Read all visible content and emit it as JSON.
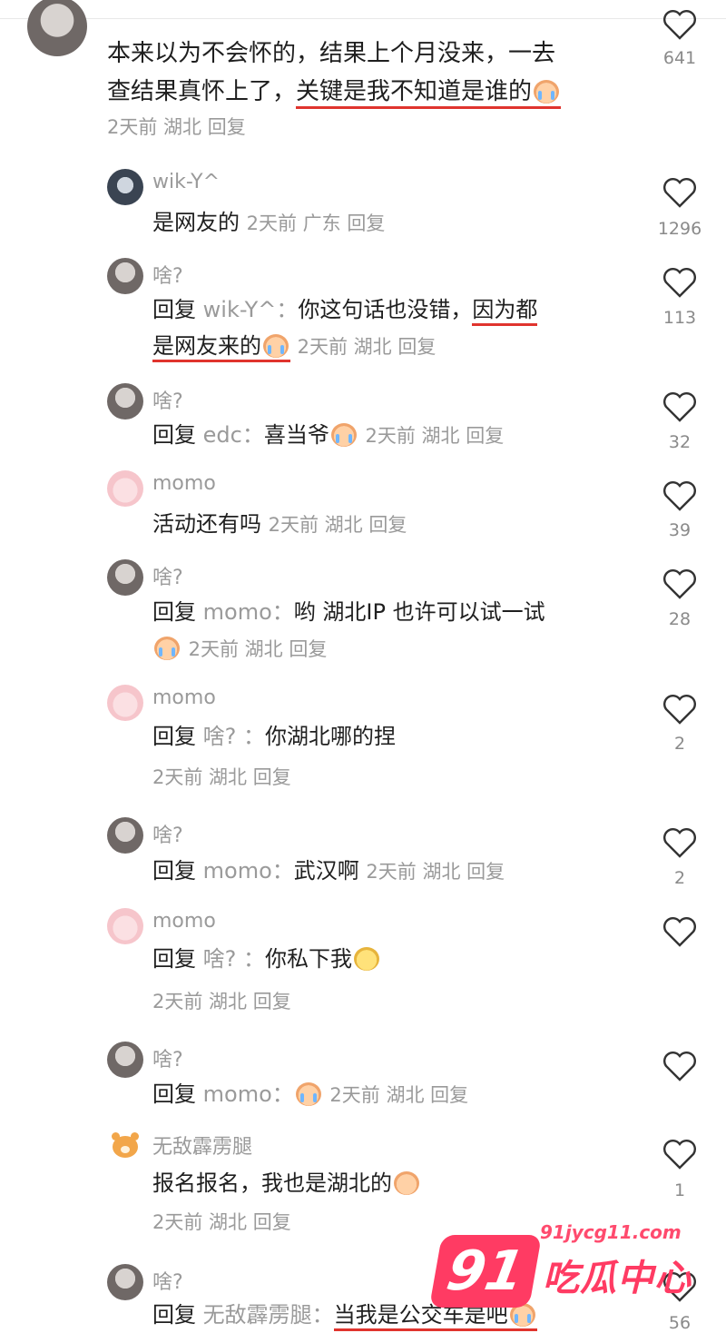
{
  "top_comment": {
    "text_line1": "本来以为不会怀的，结果上个月没来，一去",
    "text_line2_plain": "查结果真怀上了，",
    "text_line2_underlined": "关键是我不知道是谁的",
    "meta": "2天前  湖北  回复",
    "likes": "641"
  },
  "replies": [
    {
      "user": "wik-Y^",
      "text": "是网友的",
      "meta": "2天前  广东  回复",
      "likes": "1296"
    },
    {
      "user": "啥?",
      "reply_word": "回复",
      "reply_to": "wik-Y^：",
      "text_a": "你这句话也没错，",
      "text_ul1": "因为都",
      "text_ul2": "是网友来的",
      "meta": "2天前  湖北  回复",
      "likes": "113"
    },
    {
      "user": "啥?",
      "reply_word": "回复",
      "reply_to": "edc：",
      "text": "喜当爷",
      "meta": "2天前  湖北  回复",
      "likes": "32"
    },
    {
      "user": "momo",
      "text": "活动还有吗",
      "meta": "2天前  湖北  回复",
      "likes": "39"
    },
    {
      "user": "啥?",
      "reply_word": "回复",
      "reply_to": "momo：",
      "text": "哟 湖北IP 也许可以试一试",
      "meta": "2天前  湖北  回复",
      "likes": "28"
    },
    {
      "user": "momo",
      "reply_word": "回复",
      "reply_to": "啥? ：",
      "text": "你湖北哪的捏",
      "meta": "2天前  湖北  回复",
      "likes": "2"
    },
    {
      "user": "啥?",
      "reply_word": "回复",
      "reply_to": "momo：",
      "text": "武汉啊",
      "meta": "2天前  湖北  回复",
      "likes": "2"
    },
    {
      "user": "momo",
      "reply_word": "回复",
      "reply_to": "啥? ：",
      "text": "你私下我",
      "meta": "2天前  湖北  回复",
      "likes": ""
    },
    {
      "user": "啥?",
      "reply_word": "回复",
      "reply_to": "momo：",
      "text": "",
      "meta": "2天前  湖北  回复",
      "likes": ""
    },
    {
      "user": "无敌霹雳腿",
      "text": "报名报名，我也是湖北的",
      "meta": "2天前  湖北  回复",
      "likes": "1"
    },
    {
      "user": "啥?",
      "reply_word": "回复",
      "reply_to": "无敌霹雳腿：",
      "text": "当我是公交车是吧",
      "meta": "",
      "likes": "56"
    }
  ],
  "watermark": {
    "badge": "91",
    "url": "91jycg11.com",
    "text": "吃瓜中心"
  },
  "colors": {
    "underline": "#e0342e",
    "muted": "#9a9a9a",
    "watermark": "#ff3b63"
  },
  "icons": {
    "like": "heart-outline-icon"
  }
}
